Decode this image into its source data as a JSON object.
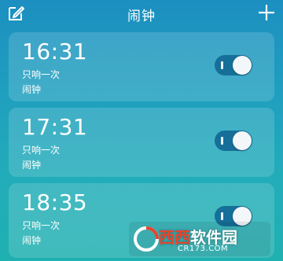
{
  "header": {
    "title": "闹钟",
    "edit_icon": "edit-icon",
    "add_icon": "plus-icon"
  },
  "alarms": [
    {
      "time": "16:31",
      "repeat": "只响一次",
      "label": "闹钟",
      "enabled": true
    },
    {
      "time": "17:31",
      "repeat": "只响一次",
      "label": "闹钟",
      "enabled": true
    },
    {
      "time": "18:35",
      "repeat": "只响一次",
      "label": "闹钟",
      "enabled": true
    }
  ],
  "watermark": {
    "brand_red": "西西",
    "brand_rest": "软件园",
    "url": "CR173.COM"
  },
  "colors": {
    "background_top": "#1c8fc0",
    "background_bottom": "#1fb0b0",
    "toggle_track": "#166f98",
    "watermark_red": "#e8432d"
  }
}
